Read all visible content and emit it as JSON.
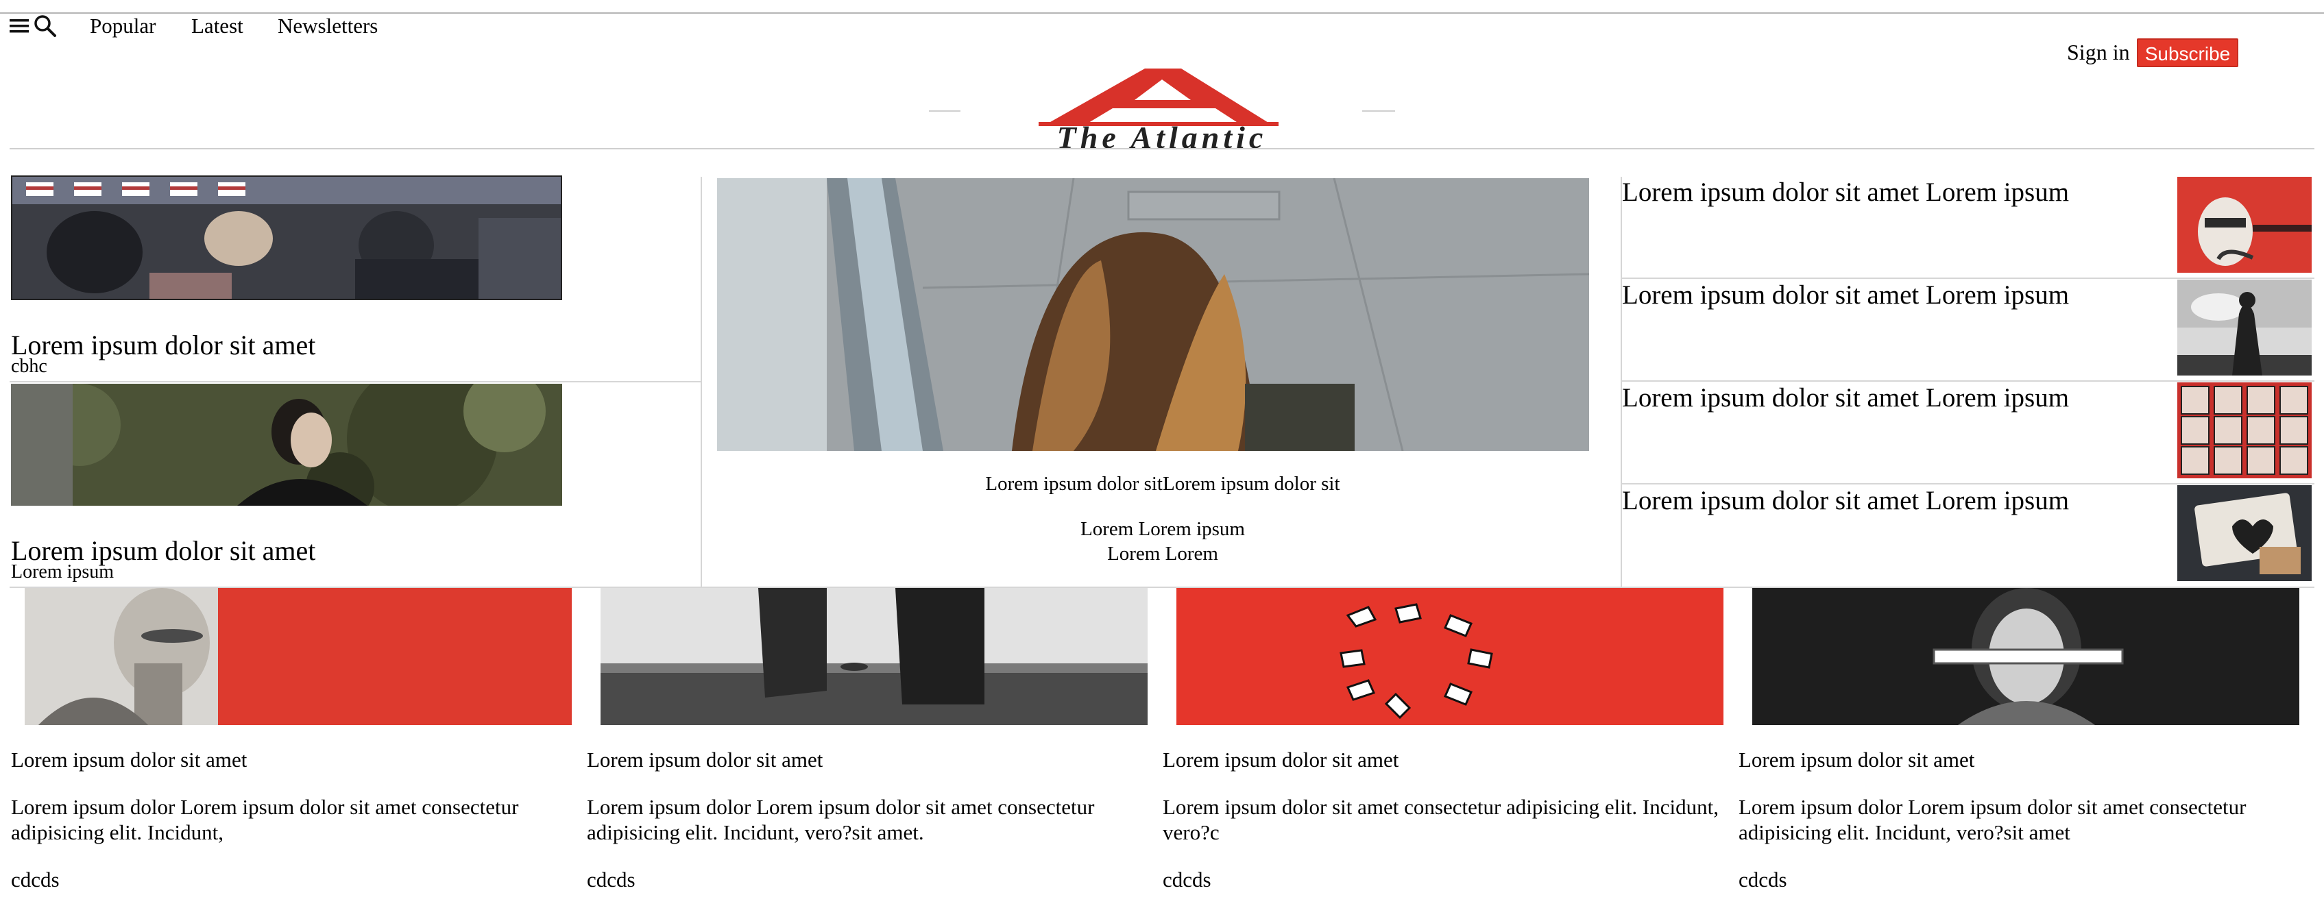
{
  "nav": {
    "links": [
      "Popular",
      "Latest",
      "Newsletters"
    ],
    "sign_in": "Sign in",
    "subscribe": "Subscribe",
    "icons": [
      "menu-icon",
      "search-icon"
    ]
  },
  "brand": {
    "logo_text": "The Atlantic",
    "accent_color": "#e5382a"
  },
  "left_stories": [
    {
      "headline": "Lorem ipsum dolor sit amet",
      "sub": "cbhc"
    },
    {
      "headline": "Lorem ipsum dolor sit amet",
      "sub": "Lorem ipsum"
    }
  ],
  "center_story": {
    "title": "Lorem ipsum dolor sitLorem ipsum dolor sit",
    "line1": "Lorem Lorem ipsum",
    "line2": "Lorem Lorem"
  },
  "right_list": [
    {
      "title": "Lorem ipsum dolor sit amet Lorem ipsum"
    },
    {
      "title": "Lorem ipsum dolor sit amet Lorem ipsum"
    },
    {
      "title": "Lorem ipsum dolor sit amet Lorem ipsum"
    },
    {
      "title": "Lorem ipsum dolor sit amet Lorem ipsum"
    }
  ],
  "cards": [
    {
      "title": "Lorem ipsum dolor sit amet",
      "body": "Lorem ipsum dolor Lorem ipsum dolor sit amet consectetur adipisicing elit. Incidunt,",
      "footer": "cdcds"
    },
    {
      "title": "Lorem ipsum dolor sit amet",
      "body": "Lorem ipsum dolor Lorem ipsum dolor sit amet consectetur adipisicing elit. Incidunt, vero?sit amet.",
      "footer": "cdcds"
    },
    {
      "title": "Lorem ipsum dolor sit amet",
      "body": "Lorem ipsum dolor sit amet consectetur adipisicing elit. Incidunt, vero?c",
      "footer": "cdcds"
    },
    {
      "title": "Lorem ipsum dolor sit amet",
      "body": "Lorem ipsum dolor Lorem ipsum dolor sit amet consectetur adipisicing elit. Incidunt, vero?sit amet",
      "footer": "cdcds"
    }
  ]
}
